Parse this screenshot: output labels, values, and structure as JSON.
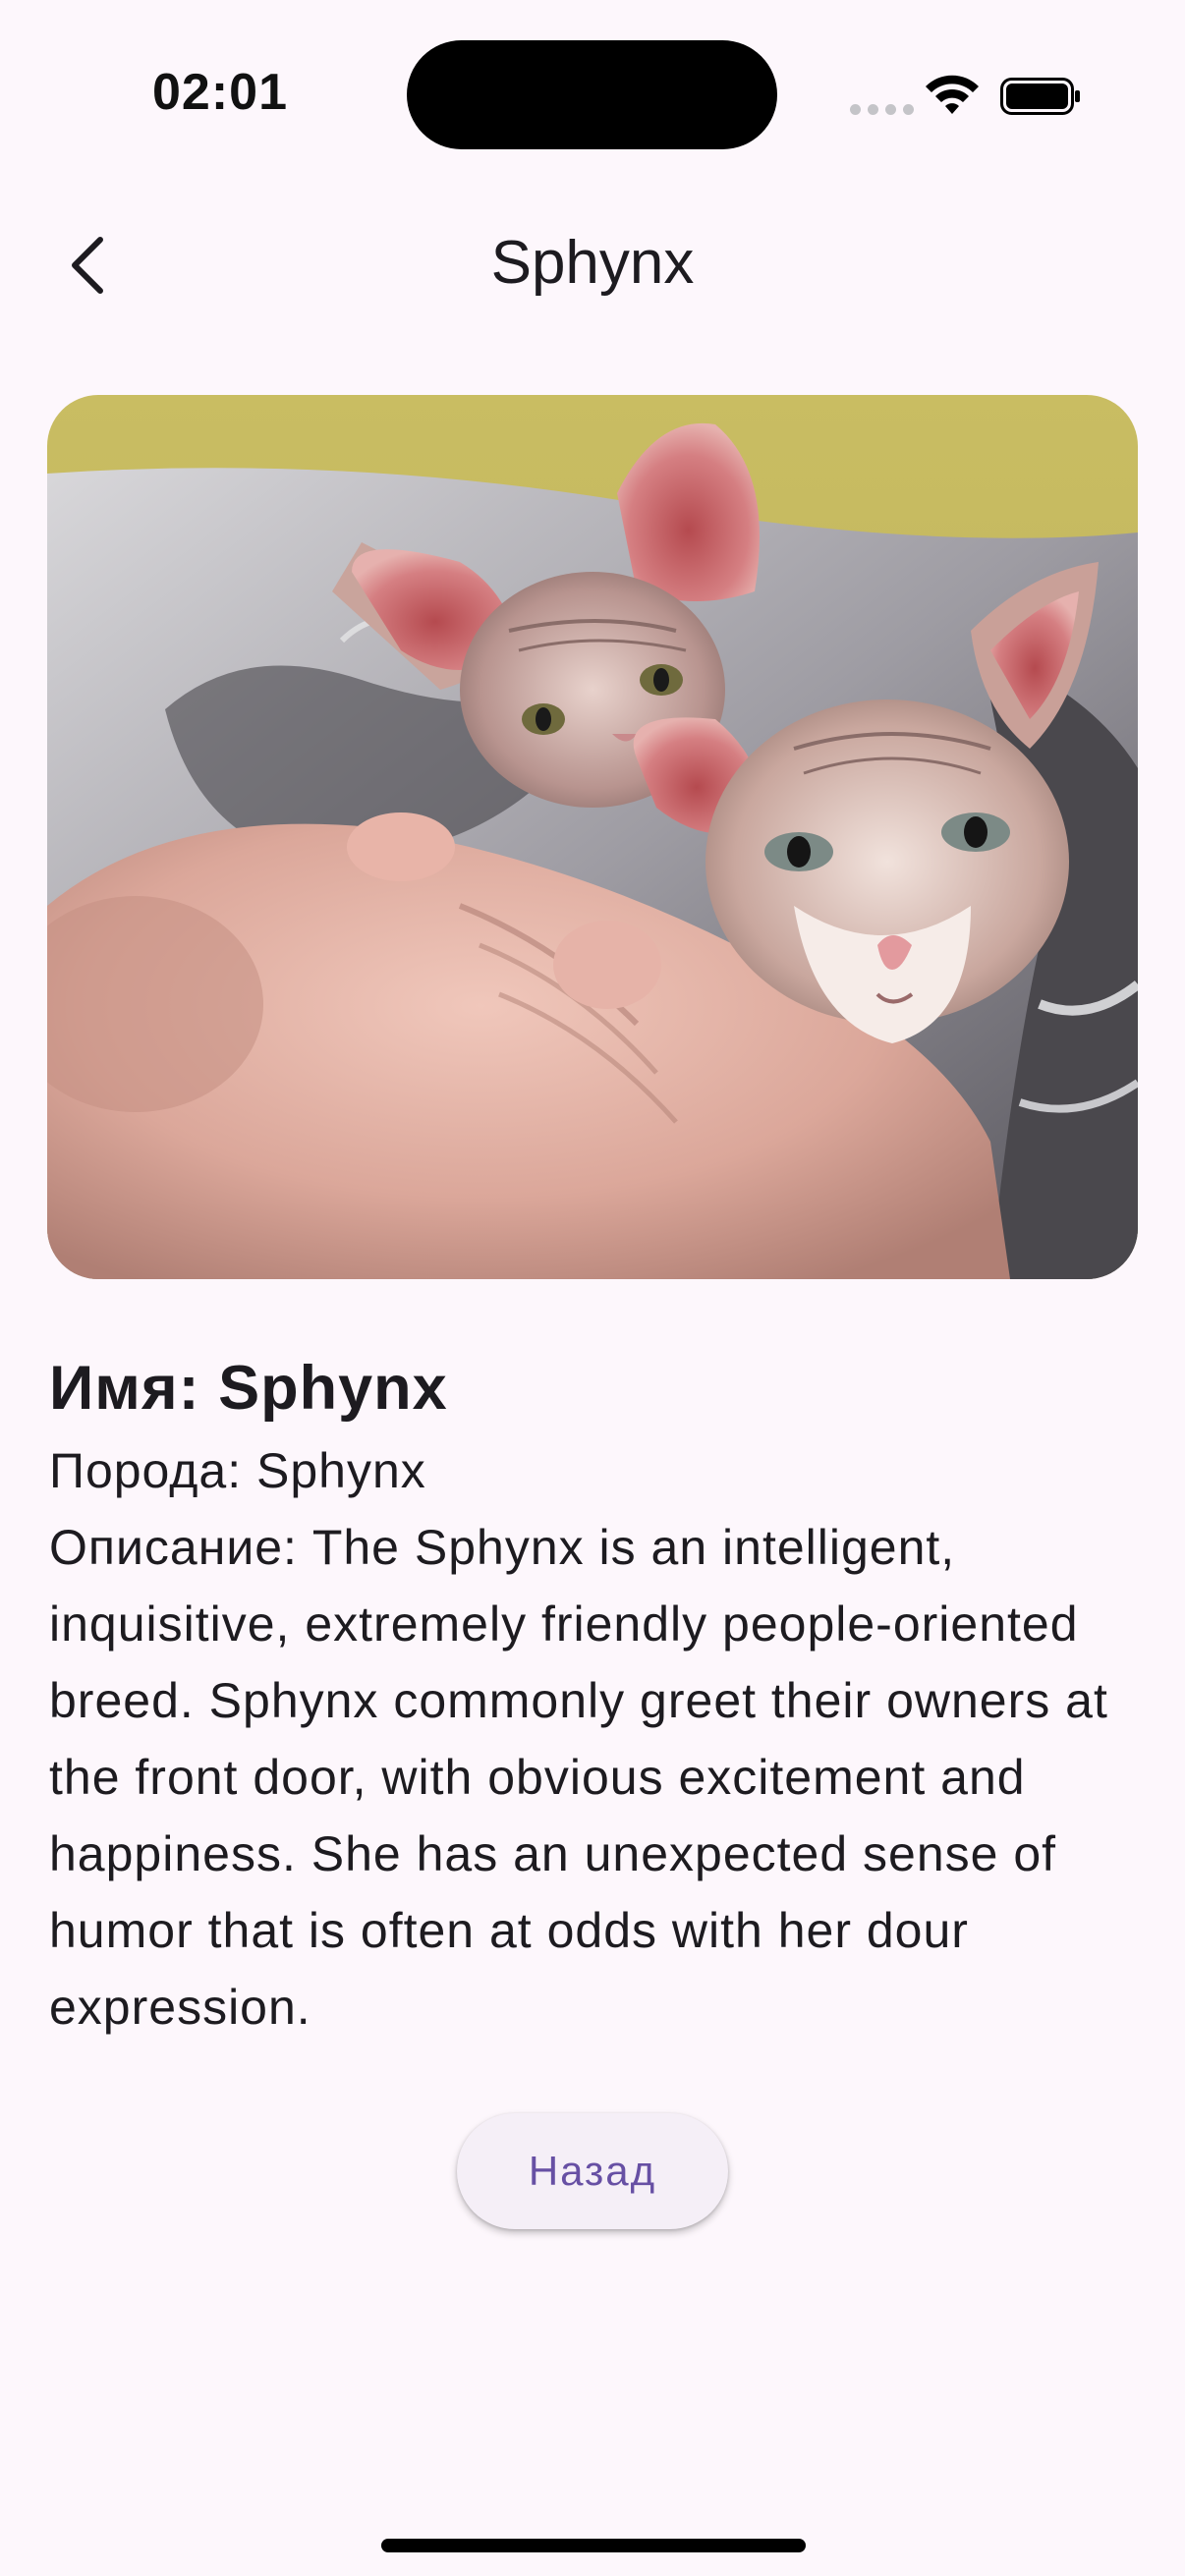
{
  "status_bar": {
    "time": "02:01"
  },
  "nav": {
    "title": "Sphynx",
    "back_icon": "chevron-left-icon"
  },
  "photo": {
    "subject": "two sphynx cats on a blanket"
  },
  "details": {
    "name": "Имя: Sphynx",
    "breed": "Порода: Sphynx",
    "description": "Описание: The Sphynx is an intelligent, inquisitive, extremely friendly people-oriented breed. Sphynx commonly greet their owners  at the front door, with obvious excitement and happiness. She has an unexpected sense of humor that is often at odds with her dour expression."
  },
  "actions": {
    "back_label": "Назад"
  },
  "colors": {
    "background": "#fdf7fc",
    "accent": "#6750a4",
    "button_bg": "#f5eff7"
  }
}
